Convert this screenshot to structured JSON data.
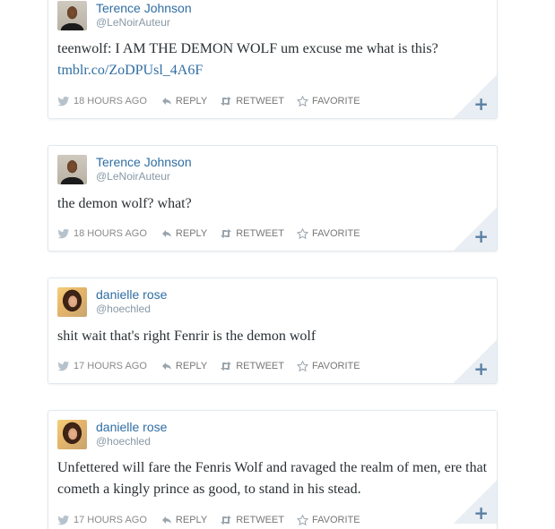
{
  "tweets": [
    {
      "name": "Terence Johnson",
      "handle": "@LeNoirAuteur",
      "text": "teenwolf: I AM THE DEMON WOLF um excuse me what is this?",
      "link": "tmblr.co/ZoDPUsl_4A6F",
      "time": "18 HOURS AGO",
      "reply": "REPLY",
      "retweet": "RETWEET",
      "favorite": "FAVORITE",
      "expand": "+"
    },
    {
      "name": "Terence Johnson",
      "handle": "@LeNoirAuteur",
      "text": "the demon wolf? what?",
      "time": "18 HOURS AGO",
      "reply": "REPLY",
      "retweet": "RETWEET",
      "favorite": "FAVORITE",
      "expand": "+"
    },
    {
      "name": "danielle rose",
      "handle": "@hoechled",
      "text": "shit wait that's right Fenrir is the demon wolf",
      "time": "17 HOURS AGO",
      "reply": "REPLY",
      "retweet": "RETWEET",
      "favorite": "FAVORITE",
      "expand": "+"
    },
    {
      "name": "danielle rose",
      "handle": "@hoechled",
      "text": "Unfettered will fare the Fenris Wolf and ravaged the realm of men, ere that cometh a kingly prince as good, to stand in his stead.",
      "time": "17 HOURS AGO",
      "reply": "REPLY",
      "retweet": "RETWEET",
      "favorite": "FAVORITE",
      "expand": "+"
    }
  ],
  "colors": {
    "name": "#2f6ea3",
    "handle": "#8899a6",
    "text": "#292f33",
    "action": "#777777",
    "border": "#e1e8ed"
  },
  "icons": {
    "bird": "twitter-bird-icon",
    "reply": "reply-arrow-icon",
    "retweet": "retweet-arrows-icon",
    "favorite": "star-outline-icon",
    "expand": "plus-icon"
  }
}
